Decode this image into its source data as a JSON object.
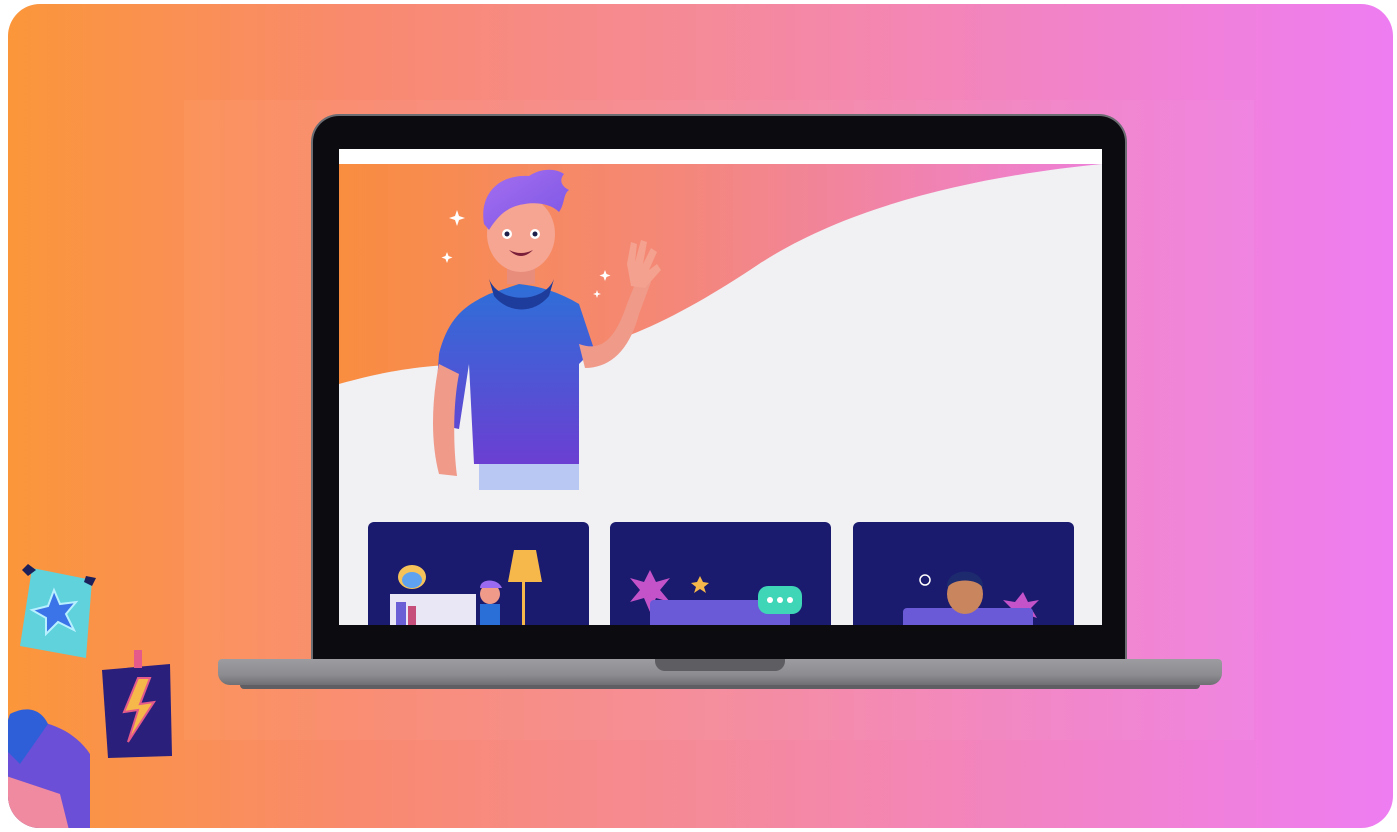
{
  "scene": {
    "title": "",
    "palette": {
      "bg_left": "#fb963a",
      "bg_right": "#ee7df2",
      "laptop_bezel": "#0c0c10",
      "laptop_body": "#8c8c91",
      "screen_bg": "#f1f0f3",
      "card_bg": "#1a1a6e"
    }
  },
  "screen": {
    "hero": {
      "illustration": "waving-character-illustration",
      "wave": "orange-to-pink-wave"
    },
    "cards": [
      {
        "illustration": "home-office-character-illustration"
      },
      {
        "illustration": "laptop-chat-illustration"
      },
      {
        "illustration": "character-with-laptop-illustration"
      }
    ]
  },
  "decorations": [
    {
      "icon": "star-sticker-icon"
    },
    {
      "icon": "lightning-sticker-icon"
    },
    {
      "icon": "character-partial-illustration"
    }
  ]
}
